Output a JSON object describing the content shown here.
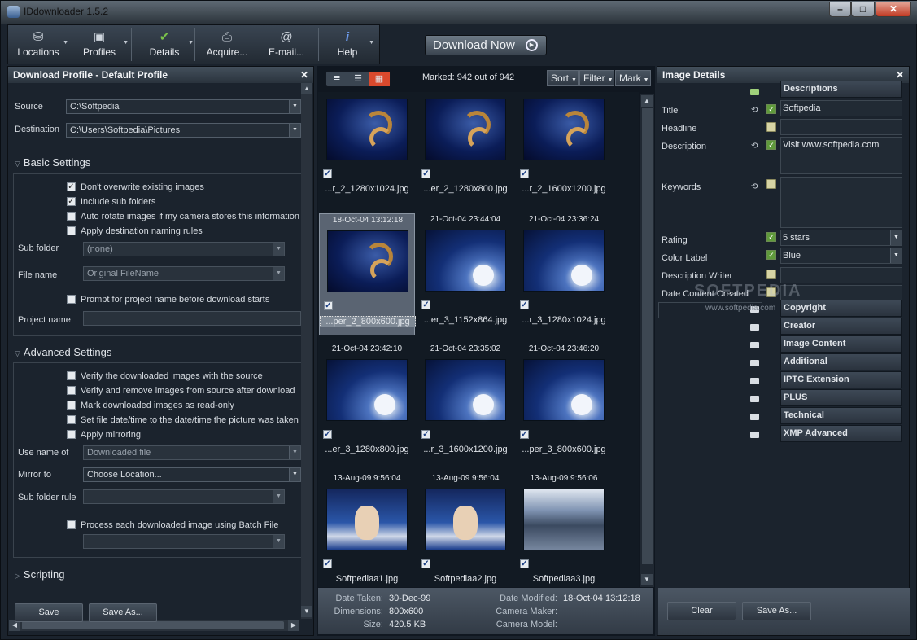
{
  "window": {
    "title": "IDdownloader 1.5.2"
  },
  "toolbar": [
    {
      "label": "Locations",
      "icon": "drive-icon",
      "dd": true
    },
    {
      "label": "Profiles",
      "icon": "camera-icon",
      "dd": true
    },
    {
      "label": "Details",
      "icon": "checkmark-pen-icon",
      "dd": true
    },
    {
      "label": "Acquire...",
      "icon": "scanner-icon",
      "dd": false
    },
    {
      "label": "E-mail...",
      "icon": "email-icon",
      "dd": false
    },
    {
      "label": "Help",
      "icon": "info-icon",
      "dd": true
    }
  ],
  "download_now": "Download Now",
  "left": {
    "header": "Download Profile - Default Profile",
    "source_label": "Source",
    "source_value": "C:\\Softpedia",
    "dest_label": "Destination",
    "dest_value": "C:\\Users\\Softpedia\\Pictures",
    "basic_title": "Basic Settings",
    "basic_checks": [
      {
        "text": "Don't overwrite existing images",
        "checked": true
      },
      {
        "text": "Include sub folders",
        "checked": true
      },
      {
        "text": "Auto rotate images if my camera stores this information",
        "checked": false
      },
      {
        "text": "Apply destination naming rules",
        "checked": false
      }
    ],
    "subfolder_label": "Sub folder",
    "subfolder_value": "(none)",
    "filename_label": "File name",
    "filename_value": "Original FileName",
    "prompt_check": "Prompt for project name before download starts",
    "project_label": "Project name",
    "advanced_title": "Advanced Settings",
    "advanced_checks": [
      "Verify the downloaded images with the source",
      "Verify and remove images from source after download",
      "Mark downloaded images as read-only",
      "Set file date/time to the date/time the picture was taken",
      "Apply mirroring"
    ],
    "usename_label": "Use name of",
    "usename_value": "Downloaded file",
    "mirror_label": "Mirror to",
    "mirror_value": "Choose Location...",
    "subrule_label": "Sub folder rule",
    "batch_check": "Process each downloaded image using Batch File",
    "scripting_title": "Scripting",
    "save": "Save",
    "saveas": "Save As..."
  },
  "mid": {
    "marked": "Marked: 942 out of 942",
    "sort": "Sort",
    "filter": "Filter",
    "mark": "Mark",
    "cells": [
      {
        "date": "",
        "name": "...r_2_1280x1024.jpg",
        "art": "wall1"
      },
      {
        "date": "",
        "name": "...er_2_1280x800.jpg",
        "art": "wall1"
      },
      {
        "date": "",
        "name": "...r_2_1600x1200.jpg",
        "art": "wall1"
      },
      {
        "date": "18-Oct-04 13:12:18",
        "name": "...per_2_800x600.jpg",
        "art": "wall1",
        "sel": true
      },
      {
        "date": "21-Oct-04 23:44:04",
        "name": "...er_3_1152x864.jpg",
        "art": "wall2"
      },
      {
        "date": "21-Oct-04 23:36:24",
        "name": "...r_3_1280x1024.jpg",
        "art": "wall2"
      },
      {
        "date": "21-Oct-04 23:42:10",
        "name": "...er_3_1280x800.jpg",
        "art": "wall2"
      },
      {
        "date": "21-Oct-04 23:35:02",
        "name": "...r_3_1600x1200.jpg",
        "art": "wall2"
      },
      {
        "date": "21-Oct-04 23:46:20",
        "name": "...per_3_800x600.jpg",
        "art": "wall2"
      },
      {
        "date": "13-Aug-09 9:56:04",
        "name": "Softpediaa1.jpg",
        "art": "wall3"
      },
      {
        "date": "13-Aug-09 9:56:04",
        "name": "Softpediaa2.jpg",
        "art": "wall3"
      },
      {
        "date": "13-Aug-09 9:56:06",
        "name": "Softpediaa3.jpg",
        "art": "wall4"
      }
    ],
    "info": {
      "date_taken_k": "Date Taken:",
      "date_taken": "30-Dec-99",
      "dimensions_k": "Dimensions:",
      "dimensions": "800x600",
      "size_k": "Size:",
      "size": "420.5 KB",
      "date_modified_k": "Date Modified:",
      "date_modified": "18-Oct-04 13:12:18",
      "camera_maker_k": "Camera Maker:",
      "camera_model_k": "Camera Model:"
    }
  },
  "right": {
    "header": "Image Details",
    "fields": [
      {
        "k": "Title",
        "v": "Softpedia"
      },
      {
        "k": "Headline",
        "v": ""
      },
      {
        "k": "Description",
        "v": "Visit www.softpedia.com"
      },
      {
        "k": "Keywords",
        "v": ""
      },
      {
        "k": "Rating",
        "v": "5 stars"
      },
      {
        "k": "Color Label",
        "v": "Blue"
      },
      {
        "k": "Description Writer",
        "v": ""
      },
      {
        "k": "Date Content Created",
        "v": ""
      }
    ],
    "sections": [
      "Descriptions",
      "Copyright",
      "Creator",
      "Image Content",
      "Additional",
      "IPTC Extension",
      "PLUS",
      "Technical",
      "XMP Advanced"
    ],
    "clear": "Clear",
    "saveas": "Save As...",
    "watermark": "SOFTPEDIA",
    "watermark_url": "www.softpedia.com"
  }
}
